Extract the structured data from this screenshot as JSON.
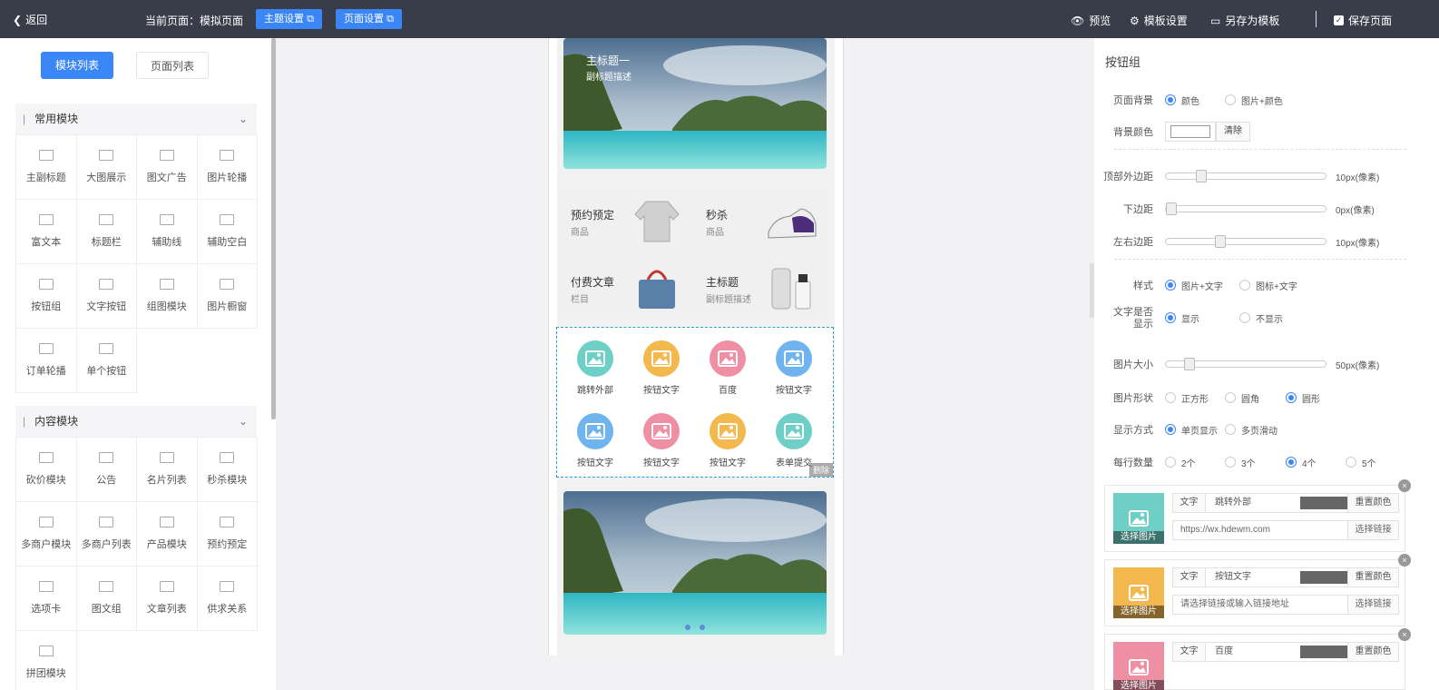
{
  "topbar": {
    "back_label": "返回",
    "current_page": "当前页面：模拟页面",
    "theme_settings": "主题设置",
    "page_settings": "页面设置",
    "preview": "预览",
    "template_settings": "模板设置",
    "save_as_template": "另存为模板",
    "save_page": "保存页面"
  },
  "left": {
    "tabs": [
      "模块列表",
      "页面列表"
    ],
    "sections": [
      {
        "title": "常用模块",
        "items": [
          {
            "label": "主副标题",
            "icon": "title-icon"
          },
          {
            "label": "大图展示",
            "icon": "image-icon"
          },
          {
            "label": "图文广告",
            "icon": "ad-icon"
          },
          {
            "label": "图片轮播",
            "icon": "carousel-icon"
          },
          {
            "label": "富文本",
            "icon": "richtext-icon"
          },
          {
            "label": "标题栏",
            "icon": "text-icon"
          },
          {
            "label": "辅助线",
            "icon": "line-icon"
          },
          {
            "label": "辅助空白",
            "icon": "blank-icon"
          },
          {
            "label": "按钮组",
            "icon": "button-group-icon"
          },
          {
            "label": "文字按钮",
            "icon": "text-button-icon"
          },
          {
            "label": "组图模块",
            "icon": "gallery-icon"
          },
          {
            "label": "图片橱窗",
            "icon": "showcase-icon"
          },
          {
            "label": "订单轮播",
            "icon": "order-carousel-icon"
          },
          {
            "label": "单个按钮",
            "icon": "single-button-icon"
          }
        ]
      },
      {
        "title": "内容模块",
        "items": [
          {
            "label": "砍价模块",
            "icon": "bargain-icon"
          },
          {
            "label": "公告",
            "icon": "notice-icon"
          },
          {
            "label": "名片列表",
            "icon": "card-list-icon"
          },
          {
            "label": "秒杀模块",
            "icon": "flash-sale-icon"
          },
          {
            "label": "多商户模块",
            "icon": "store-icon"
          },
          {
            "label": "多商户列表",
            "icon": "store-list-icon"
          },
          {
            "label": "产品模块",
            "icon": "product-icon"
          },
          {
            "label": "预约预定",
            "icon": "booking-icon"
          },
          {
            "label": "选项卡",
            "icon": "tabs-icon"
          },
          {
            "label": "图文组",
            "icon": "image-text-icon"
          },
          {
            "label": "文章列表",
            "icon": "article-list-icon"
          },
          {
            "label": "供求关系",
            "icon": "supply-icon"
          },
          {
            "label": "拼团模块",
            "icon": "group-buy-icon"
          }
        ]
      }
    ]
  },
  "preview": {
    "banner_title": "主标题一",
    "banner_subtitle": "副标题描述",
    "goods": [
      {
        "title": "预约预定",
        "sub": "商品"
      },
      {
        "title": "秒杀",
        "sub": "商品"
      },
      {
        "title": "付费文章",
        "sub": "栏目"
      },
      {
        "title": "主标题",
        "sub": "副标题描述"
      }
    ],
    "buttons": [
      {
        "label": "跳转外部",
        "color": "#6dcfc6"
      },
      {
        "label": "按钮文字",
        "color": "#f3b84e"
      },
      {
        "label": "百度",
        "color": "#ef8fa4"
      },
      {
        "label": "按钮文字",
        "color": "#6fb3ef"
      },
      {
        "label": "按钮文字",
        "color": "#6fb3ef"
      },
      {
        "label": "按钮文字",
        "color": "#ef8fa4"
      },
      {
        "label": "按钮文字",
        "color": "#f3b84e"
      },
      {
        "label": "表单提交",
        "color": "#6dcfc6"
      }
    ],
    "delete_label": "删除"
  },
  "right": {
    "title": "按钮组",
    "page_bg_label": "页面背景",
    "page_bg_options": [
      "颜色",
      "图片+颜色"
    ],
    "bg_color_label": "背景颜色",
    "clear_label": "清除",
    "top_margin_label": "顶部外边距",
    "top_margin_value": "10px(像素)",
    "top_margin_fraction": 0.2,
    "bottom_margin_label": "下边距",
    "bottom_margin_value": "0px(像素)",
    "bottom_margin_fraction": 0.0,
    "lr_margin_label": "左右边距",
    "lr_margin_value": "10px(像素)",
    "lr_margin_fraction": 0.33,
    "style_label": "样式",
    "style_options": [
      "图片+文字",
      "图标+文字"
    ],
    "text_show_label": "文字是否显示",
    "text_show_options": [
      "显示",
      "不显示"
    ],
    "img_size_label": "图片大小",
    "img_size_value": "50px(像素)",
    "img_size_fraction": 0.12,
    "img_shape_label": "图片形状",
    "img_shape_options": [
      "正方形",
      "圆角",
      "圆形"
    ],
    "display_label": "显示方式",
    "display_options": [
      "单页显示",
      "多页滑动"
    ],
    "per_row_label": "每行数量",
    "per_row_options": [
      "2个",
      "3个",
      "4个",
      "5个"
    ],
    "select_image": "选择图片",
    "text_key": "文字",
    "reset_color": "重置颜色",
    "select_link": "选择链接",
    "cards": [
      {
        "text": "跳转外部",
        "link": "https://wx.hdewm.com",
        "color": "#6dcfc6"
      },
      {
        "text": "按钮文字",
        "link": "请选择链接或输入链接地址",
        "color": "#f3b84e"
      },
      {
        "text": "百度",
        "link": "",
        "color": "#ef8fa4"
      }
    ]
  }
}
